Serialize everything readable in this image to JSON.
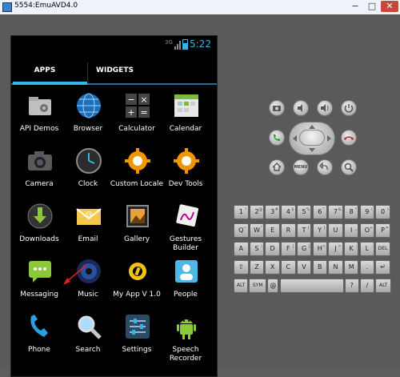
{
  "window": {
    "title": "5554:EmuAVD4.0",
    "min": "−",
    "max": "□",
    "close": "✕"
  },
  "status": {
    "signal": "3G",
    "time": "5:22"
  },
  "tabs": [
    {
      "label": "APPS",
      "selected": true
    },
    {
      "label": "WIDGETS",
      "selected": false
    }
  ],
  "apps": [
    {
      "label": "API Demos",
      "icon": "folder-gear-icon"
    },
    {
      "label": "Browser",
      "icon": "globe-icon"
    },
    {
      "label": "Calculator",
      "icon": "calculator-icon"
    },
    {
      "label": "Calendar",
      "icon": "calendar-icon"
    },
    {
      "label": "Camera",
      "icon": "camera-icon"
    },
    {
      "label": "Clock",
      "icon": "clock-icon"
    },
    {
      "label": "Custom Locale",
      "icon": "gear-icon"
    },
    {
      "label": "Dev Tools",
      "icon": "gear-icon"
    },
    {
      "label": "Downloads",
      "icon": "download-icon"
    },
    {
      "label": "Email",
      "icon": "email-icon"
    },
    {
      "label": "Gallery",
      "icon": "gallery-icon"
    },
    {
      "label": "Gestures Builder",
      "icon": "gestures-icon"
    },
    {
      "label": "Messaging",
      "icon": "messaging-icon"
    },
    {
      "label": "Music",
      "icon": "music-icon"
    },
    {
      "label": "My App V 1.0",
      "icon": "myapp-icon"
    },
    {
      "label": "People",
      "icon": "people-icon"
    },
    {
      "label": "Phone",
      "icon": "phone-icon"
    },
    {
      "label": "Search",
      "icon": "search-icon"
    },
    {
      "label": "Settings",
      "icon": "settings-icon"
    },
    {
      "label": "Speech Recorder",
      "icon": "android-icon"
    }
  ],
  "controls": {
    "menu": "MENU"
  },
  "keyboard": {
    "row1": [
      [
        "1",
        "!"
      ],
      [
        "2",
        "@"
      ],
      [
        "3",
        "#"
      ],
      [
        "4",
        "$"
      ],
      [
        "5",
        "%"
      ],
      [
        "6",
        "^"
      ],
      [
        "7",
        "&"
      ],
      [
        "8",
        "*"
      ],
      [
        "9",
        "("
      ],
      [
        "0",
        ")"
      ]
    ],
    "row2": [
      [
        "Q",
        "~"
      ],
      [
        "W",
        "\""
      ],
      [
        "E",
        "´"
      ],
      [
        "R",
        ""
      ],
      [
        "T",
        "{"
      ],
      [
        "Y",
        "}"
      ],
      [
        "U",
        "-"
      ],
      [
        "I",
        "_"
      ],
      [
        "O",
        "+"
      ],
      [
        "P",
        "="
      ]
    ],
    "row3": [
      [
        "A",
        ""
      ],
      [
        "S",
        "\\"
      ],
      [
        "D",
        ""
      ],
      [
        "F",
        "["
      ],
      [
        "G",
        "]"
      ],
      [
        "H",
        "<"
      ],
      [
        "J",
        ">"
      ],
      [
        "K",
        ";"
      ],
      [
        "L",
        ":"
      ],
      [
        "DEL",
        ""
      ]
    ],
    "row4": [
      [
        "⇧",
        ""
      ],
      [
        "Z",
        ""
      ],
      [
        "X",
        ""
      ],
      [
        "C",
        ""
      ],
      [
        "V",
        ""
      ],
      [
        "B",
        ""
      ],
      [
        "N",
        ""
      ],
      [
        "M",
        ""
      ],
      [
        ".",
        ""
      ],
      [
        "↵",
        ""
      ]
    ],
    "row5": [
      [
        "ALT",
        ""
      ],
      [
        "SYM",
        ""
      ],
      [
        "@",
        ""
      ],
      [
        "",
        ""
      ],
      [
        "?",
        ""
      ],
      [
        "/",
        ""
      ],
      [
        "ALT",
        ""
      ]
    ]
  },
  "colors": {
    "accent": "#33b5e5",
    "screen": "#000000",
    "device": "#5a5a5a"
  }
}
